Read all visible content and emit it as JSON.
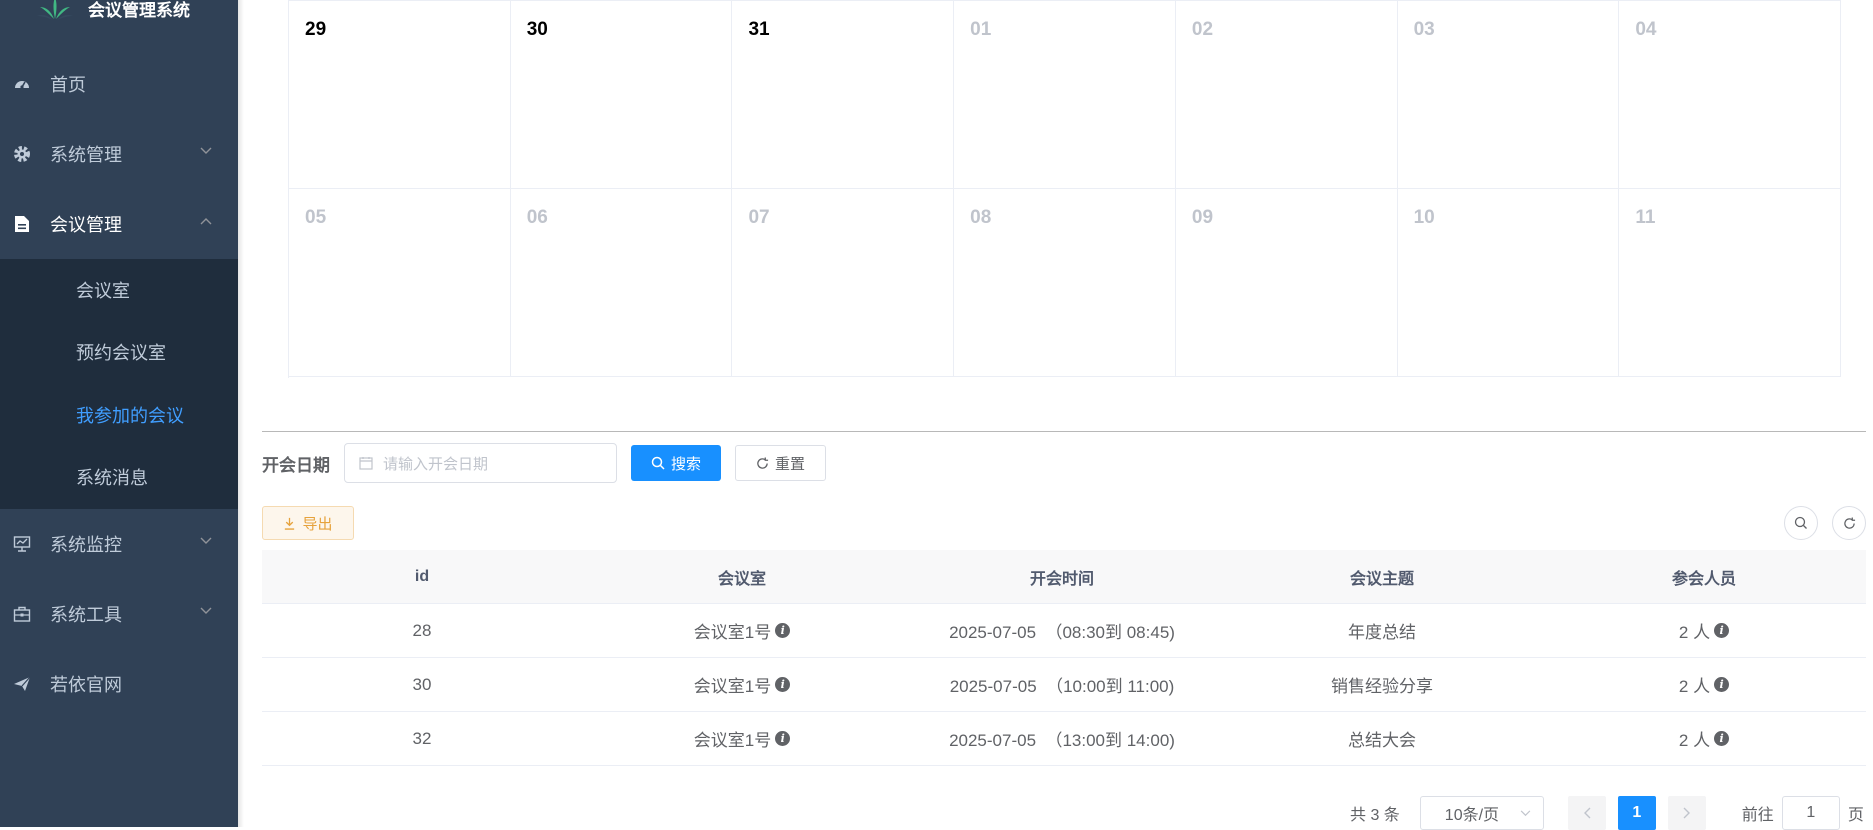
{
  "app": {
    "title": "会议管理系统"
  },
  "sidebar": {
    "items": [
      {
        "label": "首页",
        "icon": "dashboard-icon"
      },
      {
        "label": "系统管理",
        "icon": "gear-icon"
      },
      {
        "label": "会议管理",
        "icon": "document-icon"
      },
      {
        "label": "系统监控",
        "icon": "monitor-icon"
      },
      {
        "label": "系统工具",
        "icon": "toolbox-icon"
      },
      {
        "label": "若依官网",
        "icon": "paper-plane-icon"
      }
    ],
    "submenu": [
      {
        "label": "会议室"
      },
      {
        "label": "预约会议室"
      },
      {
        "label": "我参加的会议"
      },
      {
        "label": "系统消息"
      }
    ]
  },
  "calendar": {
    "rows": [
      [
        "29",
        "30",
        "31",
        "01",
        "02",
        "03",
        "04"
      ],
      [
        "05",
        "06",
        "07",
        "08",
        "09",
        "10",
        "11"
      ]
    ]
  },
  "search": {
    "label": "开会日期",
    "placeholder": "请输入开会日期",
    "search_label": "搜索",
    "reset_label": "重置"
  },
  "toolbar": {
    "export_label": "导出"
  },
  "table": {
    "headers": [
      "id",
      "会议室",
      "开会时间",
      "会议主题",
      "参会人员"
    ],
    "rows": [
      {
        "id": "28",
        "room": "会议室1号",
        "time": "2025-07-05  （08:30到 08:45)",
        "topic": "年度总结",
        "people": "2 人"
      },
      {
        "id": "30",
        "room": "会议室1号",
        "time": "2025-07-05  （10:00到 11:00)",
        "topic": "销售经验分享",
        "people": "2 人"
      },
      {
        "id": "32",
        "room": "会议室1号",
        "time": "2025-07-05  （13:00到 14:00)",
        "topic": "总结大会",
        "people": "2 人"
      }
    ]
  },
  "pagination": {
    "total": "共 3 条",
    "page_size": "10条/页",
    "current": "1",
    "goto_prefix": "前往",
    "goto_value": "1",
    "goto_suffix": "页"
  },
  "colors": {
    "sidebar_bg": "#304156",
    "submenu_bg": "#1f2d3d",
    "primary": "#1890ff",
    "active_menu": "#409eff",
    "warning": "#e6a23c"
  }
}
